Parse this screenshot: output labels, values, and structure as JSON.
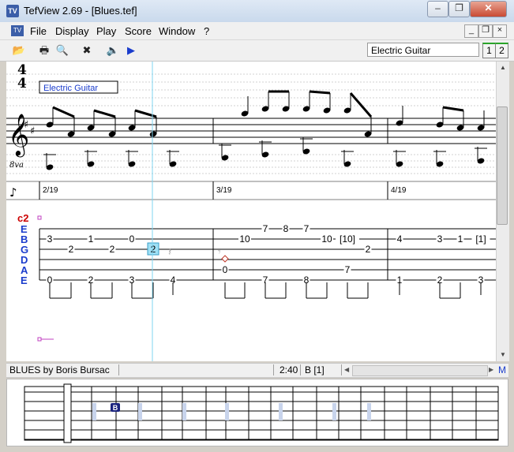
{
  "window": {
    "title": "TefView 2.69 - [Blues.tef]",
    "minimize_glyph": "–",
    "restore_glyph": "❐",
    "close_glyph": "✕",
    "app_icon_label": "TV"
  },
  "menu": {
    "items": [
      "File",
      "Display",
      "Play",
      "Score",
      "Window",
      "?"
    ],
    "mdi_minimize_glyph": "_",
    "mdi_restore_glyph": "❐",
    "mdi_close_glyph": "×"
  },
  "toolbar": {
    "buttons": [
      {
        "name": "open-icon",
        "glyph": "📂"
      },
      {
        "name": "print-icon",
        "glyph": "🖶"
      },
      {
        "name": "print-preview-icon",
        "glyph": "🔍"
      },
      {
        "name": "close-doc-icon",
        "glyph": "✖"
      },
      {
        "name": "speaker-icon",
        "glyph": "🔈"
      },
      {
        "name": "play-icon",
        "glyph": "▶"
      }
    ],
    "track_name": "Electric Guitar",
    "track_numbers": [
      "1",
      "2"
    ]
  },
  "score": {
    "time_signature_top": "4",
    "time_signature_bottom": "4",
    "instrument_label": "Electric Guitar",
    "octave_label": "8va",
    "measure_labels": [
      "2/19",
      "3/19",
      "4/19"
    ],
    "tab_header": "c2",
    "string_names": [
      "E",
      "B",
      "G",
      "D",
      "A",
      "E"
    ],
    "tab_numbers": [
      {
        "text": "3",
        "string": 1,
        "pos": 1
      },
      {
        "text": "2",
        "string": 2,
        "pos": 2
      },
      {
        "text": "1",
        "string": 1,
        "pos": 3
      },
      {
        "text": "2",
        "string": 2,
        "pos": 4
      },
      {
        "text": "0",
        "string": 1,
        "pos": 5
      },
      {
        "text": "2",
        "string": 2,
        "pos": 6,
        "highlight": true
      },
      {
        "text": "0",
        "string": 5,
        "pos": 1
      },
      {
        "text": "2",
        "string": 5,
        "pos": 3
      },
      {
        "text": "3",
        "string": 5,
        "pos": 5
      },
      {
        "text": "4",
        "string": 5,
        "pos": 7
      },
      {
        "text": "10",
        "string": 1,
        "pos": 10
      },
      {
        "text": "7",
        "string": 0,
        "pos": 11
      },
      {
        "text": "8",
        "string": 0,
        "pos": 12
      },
      {
        "text": "7",
        "string": 0,
        "pos": 13
      },
      {
        "text": "10",
        "string": 1,
        "pos": 14
      },
      {
        "text": "[10]",
        "string": 1,
        "pos": 15
      },
      {
        "text": "2",
        "string": 2,
        "pos": 16
      },
      {
        "text": "0",
        "string": 4,
        "pos": 9
      },
      {
        "text": "7",
        "string": 5,
        "pos": 11
      },
      {
        "text": "8",
        "string": 5,
        "pos": 13
      },
      {
        "text": "7",
        "string": 4,
        "pos": 15
      },
      {
        "text": "4",
        "string": 1,
        "pos": 18
      },
      {
        "text": "3",
        "string": 1,
        "pos": 20
      },
      {
        "text": "1",
        "string": 1,
        "pos": 21
      },
      {
        "text": "[1]",
        "string": 1,
        "pos": 22
      },
      {
        "text": "1",
        "string": 5,
        "pos": 18
      },
      {
        "text": "2",
        "string": 5,
        "pos": 20
      },
      {
        "text": "3",
        "string": 5,
        "pos": 22
      }
    ]
  },
  "status": {
    "song_title": "BLUES  by Boris Bursac",
    "time": "2:40",
    "section": "B [1]",
    "mode_letter": "M"
  },
  "fretboard": {
    "marker_label": "B"
  },
  "colors": {
    "cursor": "#7fd4f0",
    "tab_header": "#cc0000",
    "string_names": "#1a3ccc",
    "highlight_fill": "#9fe0f5",
    "fret_dots": "#c8d4ec",
    "marker_fill": "#1a237e"
  }
}
